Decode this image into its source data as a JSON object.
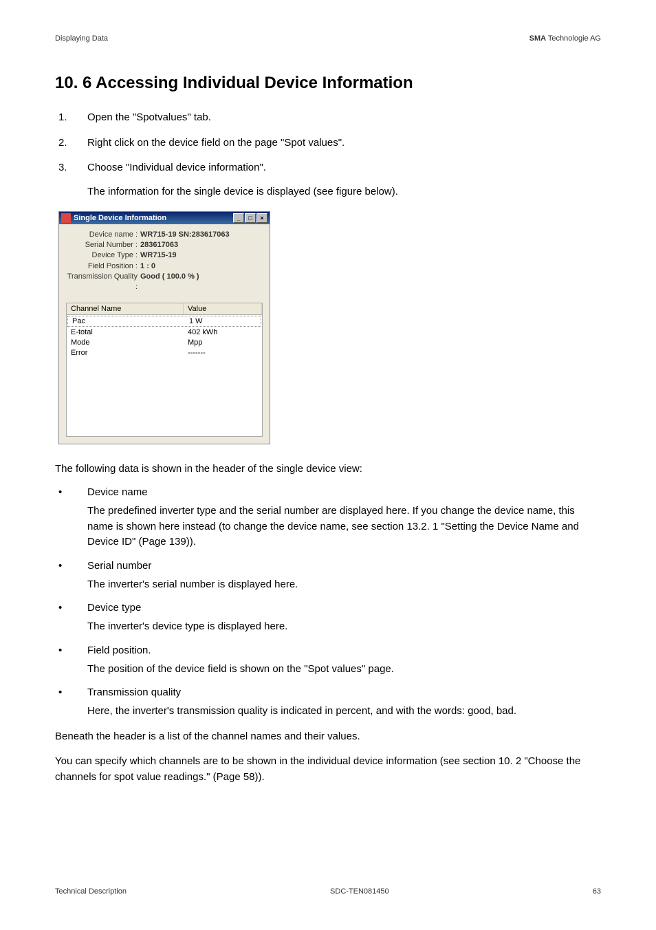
{
  "header": {
    "left": "Displaying Data",
    "right_bold": "SMA",
    "right_rest": " Technologie AG"
  },
  "title": "10. 6 Accessing Individual Device Information",
  "steps": [
    {
      "num": "1.",
      "text": "Open the \"Spotvalues\" tab."
    },
    {
      "num": "2.",
      "text": "Right click on the device field on the page \"Spot values\"."
    },
    {
      "num": "3.",
      "text": "Choose \"Individual device information\"."
    }
  ],
  "step_sub": "The information for the single device is displayed (see figure below).",
  "dialog": {
    "title": "Single Device Information",
    "info": [
      {
        "label": "Device name :",
        "value": "WR715-19 SN:283617063"
      },
      {
        "label": "Serial Number :",
        "value": "283617063"
      },
      {
        "label": "Device Type :",
        "value": "WR715-19"
      },
      {
        "label": "Field Position :",
        "value": "1 : 0"
      },
      {
        "label": "Transmission Quality :",
        "value": "Good ( 100.0 % )"
      }
    ],
    "headers": {
      "name": "Channel Name",
      "value": "Value"
    },
    "rows": [
      {
        "name": "Pac",
        "value": "1 W"
      },
      {
        "name": "E-total",
        "value": "402 kWh"
      },
      {
        "name": "Mode",
        "value": "Mpp"
      },
      {
        "name": "Error",
        "value": "-------"
      }
    ]
  },
  "intro_after": "The following data is shown in the header of the single device view:",
  "bullets": [
    {
      "title": "Device name",
      "desc": "The predefined inverter type and the serial number are displayed here. If you change the device name, this name is shown here instead (to change the device name, see section 13.2. 1 \"Setting the Device Name and Device ID\" (Page 139))."
    },
    {
      "title": "Serial number",
      "desc": "The inverter's serial number is displayed here."
    },
    {
      "title": "Device type",
      "desc": "The inverter's device type is displayed here."
    },
    {
      "title": "Field position.",
      "desc": "The position of the device field is shown on the \"Spot values\" page."
    },
    {
      "title": "Transmission quality",
      "desc": "Here, the inverter's transmission quality is indicated in percent, and with the words: good, bad."
    }
  ],
  "closing1": "Beneath the header is a list of the channel names and their values.",
  "closing2": "You can specify which channels are to be shown in the individual device information (see section 10. 2 \"Choose the channels for spot value readings.\" (Page 58)).",
  "footer": {
    "left": "Technical Description",
    "center": "SDC-TEN081450",
    "right": "63"
  }
}
